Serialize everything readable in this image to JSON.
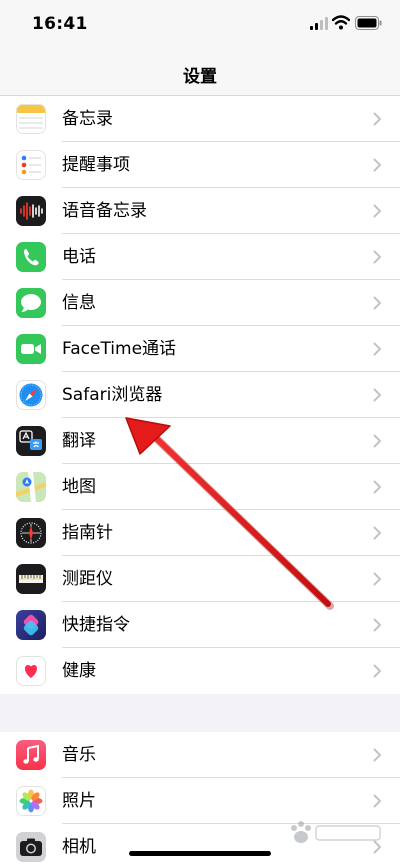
{
  "status_bar": {
    "time": "16:41"
  },
  "nav": {
    "title": "设置"
  },
  "colors": {
    "arrow": "#e31b1b",
    "chevron": "#c4c4c7",
    "separator": "#dcdce0"
  },
  "group_1": [
    {
      "label": "备忘录",
      "icon": "notes-icon"
    },
    {
      "label": "提醒事项",
      "icon": "reminders-icon"
    },
    {
      "label": "语音备忘录",
      "icon": "voice-memos-icon"
    },
    {
      "label": "电话",
      "icon": "phone-icon"
    },
    {
      "label": "信息",
      "icon": "messages-icon"
    },
    {
      "label": "FaceTime通话",
      "icon": "facetime-icon"
    },
    {
      "label": "Safari浏览器",
      "icon": "safari-icon"
    },
    {
      "label": "翻译",
      "icon": "translate-icon"
    },
    {
      "label": "地图",
      "icon": "maps-icon"
    },
    {
      "label": "指南针",
      "icon": "compass-icon"
    },
    {
      "label": "测距仪",
      "icon": "measure-icon"
    },
    {
      "label": "快捷指令",
      "icon": "shortcuts-icon"
    },
    {
      "label": "健康",
      "icon": "health-icon"
    }
  ],
  "group_2": [
    {
      "label": "音乐",
      "icon": "music-icon"
    },
    {
      "label": "照片",
      "icon": "photos-icon"
    },
    {
      "label": "相机",
      "icon": "camera-icon"
    }
  ]
}
